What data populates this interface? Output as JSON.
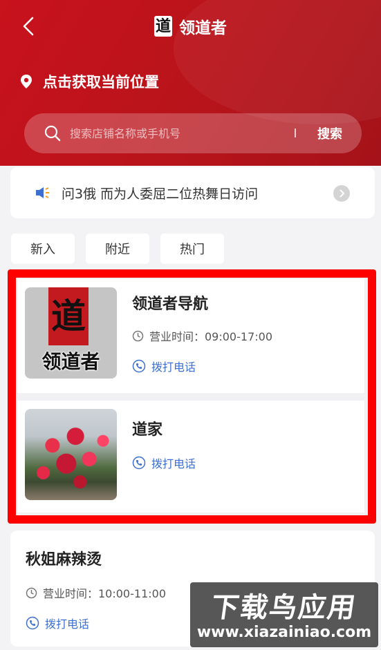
{
  "header": {
    "title": "领道者",
    "logo_char": "道",
    "location_label": "点击获取当前位置"
  },
  "search": {
    "placeholder": "搜索店铺名称或手机号",
    "button_label": "搜索"
  },
  "notice": {
    "text": "问3俄 而为人委屈二位热舞日访问"
  },
  "tabs": [
    {
      "label": "新入"
    },
    {
      "label": "附近"
    },
    {
      "label": "热门"
    }
  ],
  "stores": [
    {
      "name": "领道者导航",
      "thumb_char": "道",
      "thumb_label": "领道者",
      "hours": "营业时间：09:00-17:00",
      "call_label": "拨打电话"
    },
    {
      "name": "道家",
      "call_label": "拨打电话"
    },
    {
      "name": "秋姐麻辣烫",
      "hours": "营业时间：10:00-11:00",
      "call_label": "拨打电话"
    }
  ],
  "watermark": {
    "title": "下载鸟应用",
    "url": "www.xiazainiao.com"
  },
  "colors": {
    "header_red": "#c8121c",
    "highlight_red": "#ff0000",
    "call_blue": "#3d6fd0",
    "page_bg": "#f3f3f5"
  },
  "icons": [
    "back-arrow-icon",
    "location-pin-icon",
    "search-icon",
    "speaker-icon",
    "chevron-right-icon",
    "clock-icon",
    "phone-icon"
  ]
}
